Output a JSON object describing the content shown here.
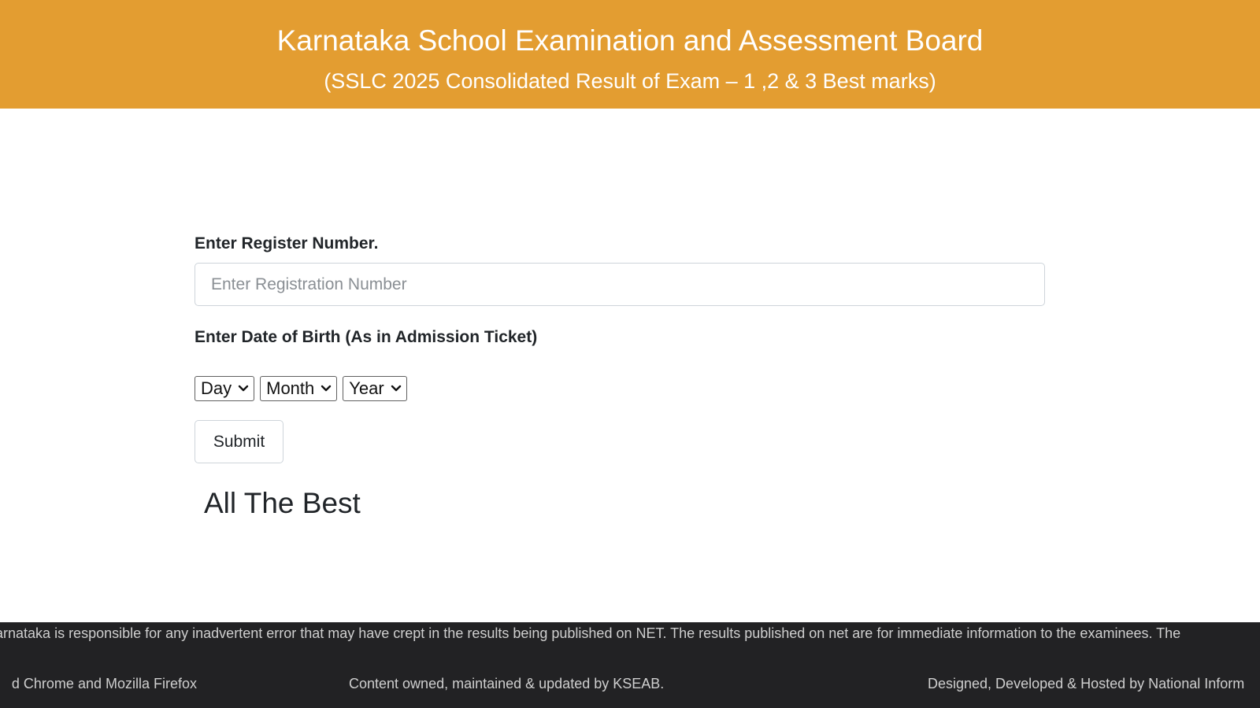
{
  "header": {
    "title": "Karnataka School Examination and Assessment Board",
    "subtitle": "(SSLC 2025 Consolidated Result of Exam – 1 ,2 & 3 Best marks)"
  },
  "form": {
    "register_label": "Enter Register Number.",
    "register_placeholder": "Enter Registration Number",
    "register_value": "",
    "dob_label": "Enter Date of Birth (As in Admission Ticket)",
    "day_selected": "Day",
    "month_selected": "Month",
    "year_selected": "Year",
    "submit_label": "Submit",
    "message": "All The Best"
  },
  "footer": {
    "marquee_text": "B, Karnataka is responsible for any inadvertent error that may have crept in the results being published on NET. The results published on net are for immediate information to the examinees. The",
    "left_text": "d Chrome and Mozilla Firefox",
    "center_text": "Content owned, maintained & updated by KSEAB.",
    "right_text": "Designed, Developed & Hosted by National Inform"
  },
  "colors": {
    "header_bg": "#e39d31",
    "footer_bg": "#222224"
  },
  "icons": {
    "select_arrow": "chevron-down-icon"
  }
}
